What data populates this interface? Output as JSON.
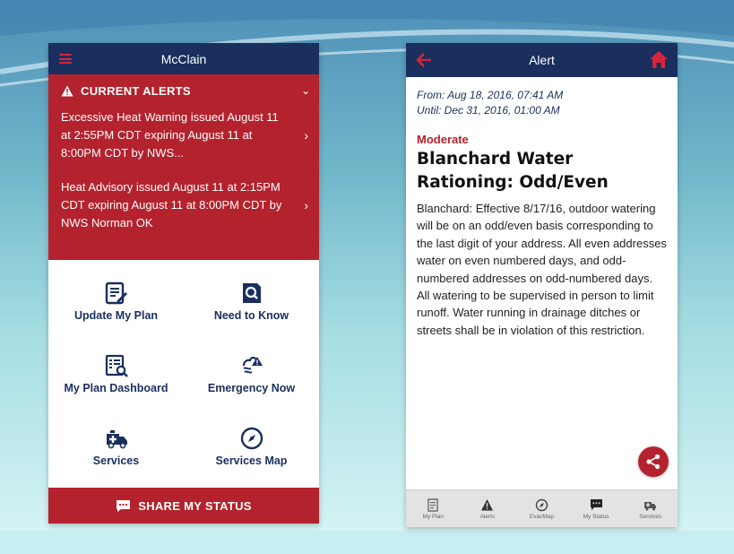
{
  "colors": {
    "navy": "#1a2f5e",
    "red": "#b3222d",
    "white": "#ffffff"
  },
  "left_screen": {
    "header": {
      "title": "McClain",
      "menu_icon": "hamburger-icon"
    },
    "alerts": {
      "title": "CURRENT ALERTS",
      "items": [
        {
          "text": "Excessive Heat Warning issued August 11 at 2:55PM CDT expiring August 11 at 8:00PM CDT by NWS..."
        },
        {
          "text": "Heat Advisory issued August 11 at 2:15PM CDT expiring August 11 at 8:00PM CDT by NWS Norman OK"
        }
      ]
    },
    "tiles": [
      {
        "label": "Update My Plan",
        "icon": "checklist-edit-icon"
      },
      {
        "label": "Need to Know",
        "icon": "document-search-icon"
      },
      {
        "label": "My Plan Dashboard",
        "icon": "dashboard-search-icon"
      },
      {
        "label": "Emergency Now",
        "icon": "storm-alert-icon"
      },
      {
        "label": "Services",
        "icon": "ambulance-icon"
      },
      {
        "label": "Services Map",
        "icon": "compass-icon"
      }
    ],
    "share_bar": {
      "label": "SHARE MY STATUS",
      "icon": "chat-bubble-icon"
    }
  },
  "right_screen": {
    "header": {
      "title": "Alert",
      "back_icon": "back-arrow-icon",
      "home_icon": "home-icon"
    },
    "alert": {
      "from": "From: Aug 18, 2016, 07:41 AM",
      "until": "Until: Dec 31, 2016, 01:00 AM",
      "severity": "Moderate",
      "title": "Blanchard Water Rationing: Odd/Even",
      "body": "Blanchard:  Effective 8/17/16, outdoor watering will be on an odd/even basis corresponding to the last digit of your address.  All even addresses water on even numbered days, and odd-numbered addresses on odd-numbered days.\nAll watering to be supervised in person to limit runoff.  Water running in drainage ditches or streets shall be in violation of this restriction."
    },
    "share_icon": "share-icon",
    "tabs": [
      {
        "label": "My Plan",
        "icon": "plan-icon"
      },
      {
        "label": "Alerts",
        "icon": "alert-triangle-icon"
      },
      {
        "label": "EvacMap",
        "icon": "compass-icon"
      },
      {
        "label": "My Status",
        "icon": "chat-bubble-icon"
      },
      {
        "label": "Services",
        "icon": "ambulance-icon"
      }
    ]
  }
}
